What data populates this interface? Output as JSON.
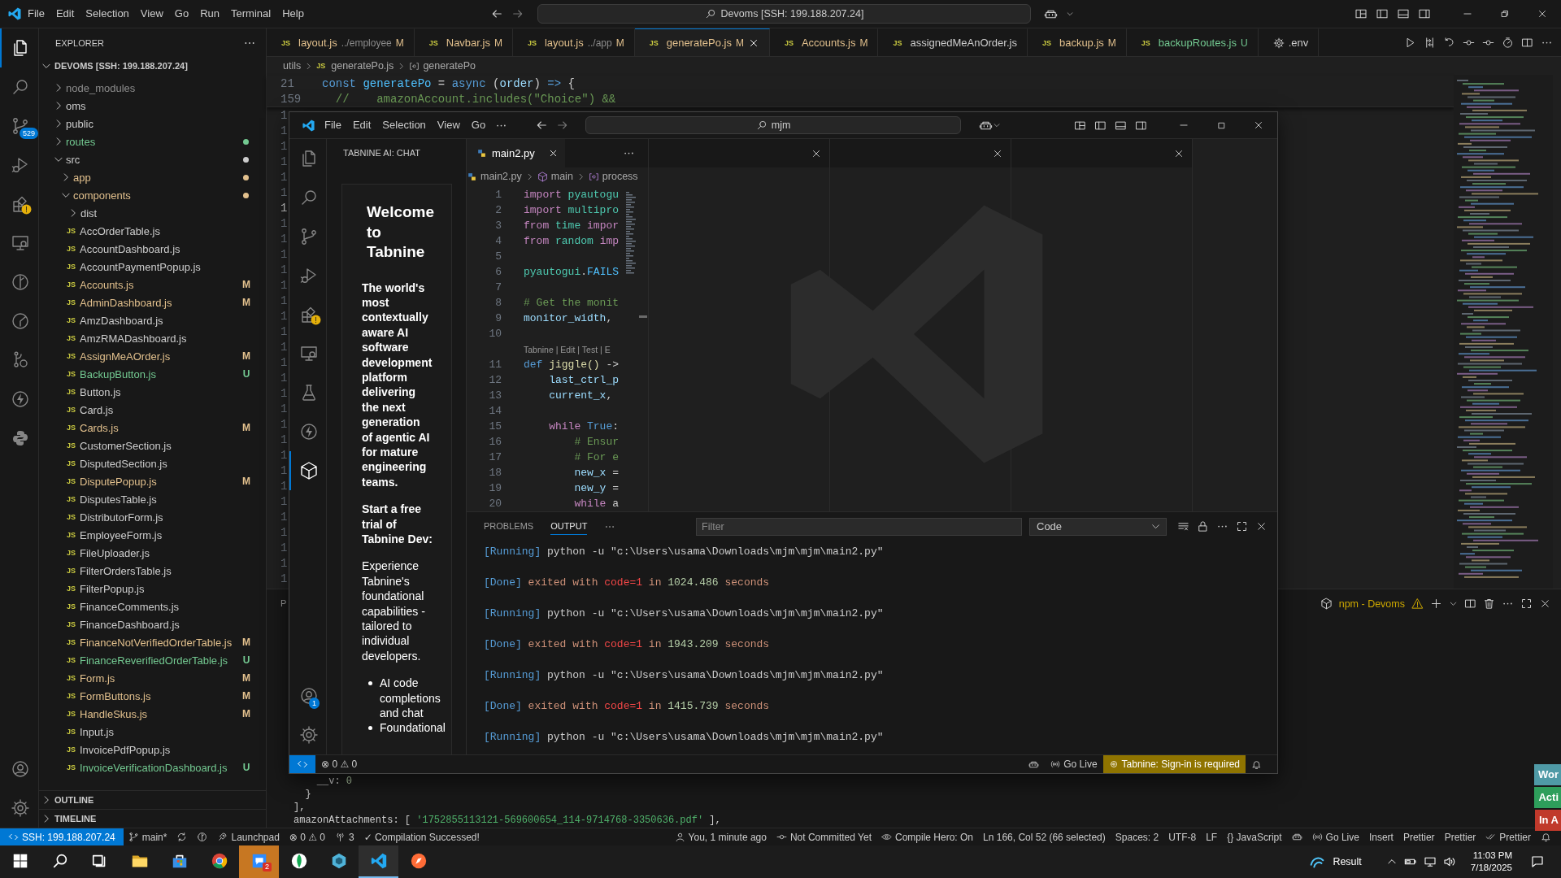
{
  "window": {
    "title": "Devoms [SSH: 199.188.207.24]",
    "menu": [
      "File",
      "Edit",
      "Selection",
      "View",
      "Go",
      "Run",
      "Terminal",
      "Help"
    ]
  },
  "activity_bar": {
    "items": [
      {
        "kind": "files",
        "selected": true,
        "warning": false
      },
      {
        "kind": "search",
        "selected": false,
        "warning": false
      },
      {
        "kind": "scm",
        "selected": false,
        "warning": false,
        "badge": "529"
      },
      {
        "kind": "run",
        "selected": false,
        "warning": false
      },
      {
        "kind": "extensions",
        "selected": false,
        "warning": true
      },
      {
        "kind": "remote",
        "selected": false,
        "warning": false
      },
      {
        "kind": "graph",
        "selected": false,
        "warning": false
      },
      {
        "kind": "gauge",
        "selected": false,
        "warning": false
      },
      {
        "kind": "branch",
        "selected": false,
        "warning": false
      },
      {
        "kind": "bolt",
        "selected": false,
        "warning": false
      },
      {
        "kind": "python",
        "selected": false,
        "warning": false
      }
    ],
    "bottom": [
      {
        "kind": "account",
        "selected": false
      },
      {
        "kind": "settings",
        "selected": false
      }
    ]
  },
  "explorer": {
    "title": "EXPLORER",
    "root": "DEVOMS [SSH: 199.188.207.24]",
    "root_expanded": true,
    "tree": [
      {
        "name": "node_modules",
        "kind": "folder",
        "expanded": false,
        "color": "#8c8c8c",
        "dot": false
      },
      {
        "name": "oms",
        "kind": "folder",
        "expanded": false,
        "color": "#cccccc",
        "dot": false
      },
      {
        "name": "public",
        "kind": "folder",
        "expanded": false,
        "color": "#cccccc",
        "dot": false
      },
      {
        "name": "routes",
        "kind": "folder",
        "expanded": false,
        "color": "#73c991",
        "dot": true
      },
      {
        "name": "src",
        "kind": "folder",
        "expanded": true,
        "color": "#cccccc",
        "dot": true,
        "children": [
          {
            "name": "app",
            "kind": "folder",
            "expanded": false,
            "color": "#e2c08d",
            "dot": true
          },
          {
            "name": "components",
            "kind": "folder",
            "expanded": true,
            "color": "#e2c08d",
            "dot": true,
            "children": [
              {
                "name": "dist",
                "kind": "folder",
                "expanded": false,
                "color": "#cccccc",
                "dot": false
              },
              {
                "name": "AccOrderTable.js",
                "kind": "file",
                "icon": "JS",
                "color": "#cccccc"
              },
              {
                "name": "AccountDashboard.js",
                "kind": "file",
                "icon": "JS",
                "color": "#cccccc"
              },
              {
                "name": "AccountPaymentPopup.js",
                "kind": "file",
                "icon": "JS",
                "color": "#cccccc"
              },
              {
                "name": "Accounts.js",
                "kind": "file",
                "icon": "JS",
                "color": "#e2c08d",
                "badge": "M"
              },
              {
                "name": "AdminDashboard.js",
                "kind": "file",
                "icon": "JS",
                "color": "#e2c08d",
                "badge": "M"
              },
              {
                "name": "AmzDashboard.js",
                "kind": "file",
                "icon": "JS",
                "color": "#cccccc"
              },
              {
                "name": "AmzRMADashboard.js",
                "kind": "file",
                "icon": "JS",
                "color": "#cccccc"
              },
              {
                "name": "AssignMeAOrder.js",
                "kind": "file",
                "icon": "JS",
                "color": "#e2c08d",
                "badge": "M"
              },
              {
                "name": "BackupButton.js",
                "kind": "file",
                "icon": "JS",
                "color": "#73c991",
                "badge": "U"
              },
              {
                "name": "Button.js",
                "kind": "file",
                "icon": "JS",
                "color": "#cccccc"
              },
              {
                "name": "Card.js",
                "kind": "file",
                "icon": "JS",
                "color": "#cccccc"
              },
              {
                "name": "Cards.js",
                "kind": "file",
                "icon": "JS",
                "color": "#e2c08d",
                "badge": "M"
              },
              {
                "name": "CustomerSection.js",
                "kind": "file",
                "icon": "JS",
                "color": "#cccccc"
              },
              {
                "name": "DisputedSection.js",
                "kind": "file",
                "icon": "JS",
                "color": "#cccccc"
              },
              {
                "name": "DisputePopup.js",
                "kind": "file",
                "icon": "JS",
                "color": "#e2c08d",
                "badge": "M"
              },
              {
                "name": "DisputesTable.js",
                "kind": "file",
                "icon": "JS",
                "color": "#cccccc"
              },
              {
                "name": "DistributorForm.js",
                "kind": "file",
                "icon": "JS",
                "color": "#cccccc"
              },
              {
                "name": "EmployeeForm.js",
                "kind": "file",
                "icon": "JS",
                "color": "#cccccc"
              },
              {
                "name": "FileUploader.js",
                "kind": "file",
                "icon": "JS",
                "color": "#cccccc"
              },
              {
                "name": "FilterOrdersTable.js",
                "kind": "file",
                "icon": "JS",
                "color": "#cccccc"
              },
              {
                "name": "FilterPopup.js",
                "kind": "file",
                "icon": "JS",
                "color": "#cccccc"
              },
              {
                "name": "FinanceComments.js",
                "kind": "file",
                "icon": "JS",
                "color": "#cccccc"
              },
              {
                "name": "FinanceDashboard.js",
                "kind": "file",
                "icon": "JS",
                "color": "#cccccc"
              },
              {
                "name": "FinanceNotVerifiedOrderTable.js",
                "kind": "file",
                "icon": "JS",
                "color": "#e2c08d",
                "badge": "M"
              },
              {
                "name": "FinanceReverifiedOrderTable.js",
                "kind": "file",
                "icon": "JS",
                "color": "#73c991",
                "badge": "U"
              },
              {
                "name": "Form.js",
                "kind": "file",
                "icon": "JS",
                "color": "#e2c08d",
                "badge": "M"
              },
              {
                "name": "FormButtons.js",
                "kind": "file",
                "icon": "JS",
                "color": "#e2c08d",
                "badge": "M"
              },
              {
                "name": "HandleSkus.js",
                "kind": "file",
                "icon": "JS",
                "color": "#e2c08d",
                "badge": "M"
              },
              {
                "name": "Input.js",
                "kind": "file",
                "icon": "JS",
                "color": "#cccccc"
              },
              {
                "name": "InvoicePdfPopup.js",
                "kind": "file",
                "icon": "JS",
                "color": "#cccccc"
              },
              {
                "name": "InvoiceVerificationDashboard.js",
                "kind": "file",
                "icon": "JS",
                "color": "#73c991",
                "badge": "U"
              }
            ]
          }
        ]
      }
    ],
    "sections": [
      {
        "title": "OUTLINE",
        "expanded": false
      },
      {
        "title": "TIMELINE",
        "expanded": false
      }
    ]
  },
  "tabs": [
    {
      "icon": "JS",
      "label": "layout.js",
      "hint": "../employee",
      "badge": "M",
      "color": "#e2c08d",
      "selected": false
    },
    {
      "icon": "JS",
      "label": "Navbar.js",
      "badge": "M",
      "color": "#e2c08d",
      "selected": false
    },
    {
      "icon": "JS",
      "label": "layout.js",
      "hint": "../app",
      "badge": "M",
      "color": "#e2c08d",
      "selected": false
    },
    {
      "icon": "JS",
      "label": "generatePo.js",
      "badge": "M",
      "color": "#e2c08d",
      "selected": true
    },
    {
      "icon": "JS",
      "label": "Accounts.js",
      "badge": "M",
      "color": "#e2c08d",
      "selected": false
    },
    {
      "icon": "JS",
      "label": "assignedMeAnOrder.js",
      "color": "#cccccc",
      "selected": false
    },
    {
      "icon": "JS",
      "label": "backup.js",
      "badge": "M",
      "color": "#e2c08d",
      "selected": false
    },
    {
      "icon": "JS",
      "label": "backupRoutes.js",
      "badge": "U",
      "color": "#73c991",
      "selected": false
    },
    {
      "kind": "settings",
      "label": ".env",
      "color": "#cccccc",
      "selected": false
    }
  ],
  "breadcrumb": [
    {
      "kind": "folder",
      "text": "utils"
    },
    {
      "kind": "js",
      "icon": "JS",
      "text": "generatePo.js"
    },
    {
      "kind": "symbol",
      "text": "generatePo"
    }
  ],
  "editor": {
    "sticky_lines": [
      {
        "number": "21",
        "tokens": [
          {
            "text": "const ",
            "kind": "kw"
          },
          {
            "text": "generatePo",
            "kind": "const"
          },
          {
            "text": " = ",
            "kind": "p"
          },
          {
            "text": "async",
            "kind": "kw"
          },
          {
            "text": " (",
            "kind": "p"
          },
          {
            "text": "order",
            "kind": "var"
          },
          {
            "text": ") ",
            "kind": "p"
          },
          {
            "text": "=>",
            "kind": "kw"
          },
          {
            "text": " {",
            "kind": "p"
          }
        ]
      },
      {
        "number": "159",
        "tokens": [
          {
            "text": "  //    amazonAccount.includes(\"Choice\") &&",
            "kind": "cm"
          }
        ]
      }
    ],
    "gutter": [
      {
        "number": "1",
        "current": false
      },
      {
        "number": "1",
        "current": false
      },
      {
        "number": "1",
        "current": false
      },
      {
        "number": "1",
        "current": false
      },
      {
        "number": "1",
        "current": false
      },
      {
        "number": "1",
        "current": false
      },
      {
        "number": "1",
        "current": true
      },
      {
        "number": "1",
        "current": false
      },
      {
        "number": "1",
        "current": false
      },
      {
        "number": "1",
        "current": false
      },
      {
        "number": "1",
        "current": false
      },
      {
        "number": "1",
        "current": false
      },
      {
        "number": "1",
        "current": false
      },
      {
        "number": "1",
        "current": false
      },
      {
        "number": "1",
        "current": false
      },
      {
        "number": "1",
        "current": false
      },
      {
        "number": "1",
        "current": false
      },
      {
        "number": "1",
        "current": false
      },
      {
        "number": "1",
        "current": false
      },
      {
        "number": "1",
        "current": false
      },
      {
        "number": "1",
        "current": false
      },
      {
        "number": "1",
        "current": false
      },
      {
        "number": "1",
        "current": false
      },
      {
        "number": "1",
        "current": false
      },
      {
        "number": "1",
        "current": false
      },
      {
        "number": "1",
        "current": false
      },
      {
        "number": "1",
        "current": false
      },
      {
        "number": "1",
        "current": false
      },
      {
        "number": "1",
        "current": false
      },
      {
        "number": "1",
        "current": false
      },
      {
        "number": "1",
        "current": false
      }
    ]
  },
  "panel": {
    "tabs": [
      {
        "label": "P",
        "selected": false
      }
    ],
    "terminal": "npm - Devoms",
    "terminal_warning": true,
    "lines": [
      {
        "tokens": [
          {
            "text": "    __v: ",
            "kind": "p"
          },
          {
            "text": "0",
            "kind": "num"
          }
        ]
      },
      {
        "tokens": [
          {
            "text": "  }",
            "kind": "p"
          }
        ]
      },
      {
        "tokens": [
          {
            "text": "],",
            "kind": "p"
          }
        ]
      },
      {
        "tokens": [
          {
            "text": "amazonAttachments: [ ",
            "kind": "p"
          },
          {
            "text": "'1752855113121-569600654_114-9714768-3350636.pdf'",
            "kind": "tstr"
          },
          {
            "text": " ],",
            "kind": "p"
          }
        ]
      }
    ]
  },
  "inner_window": {
    "menu": [
      "File",
      "Edit",
      "Selection",
      "View",
      "Go"
    ],
    "search": "mjm",
    "activity_bar": {
      "items": [
        {
          "kind": "files",
          "selected": false,
          "warning": false
        },
        {
          "kind": "search",
          "selected": false,
          "warning": false
        },
        {
          "kind": "scm",
          "selected": false,
          "warning": false
        },
        {
          "kind": "run",
          "selected": false,
          "warning": false
        },
        {
          "kind": "extensions",
          "selected": false,
          "warning": true
        },
        {
          "kind": "remote",
          "selected": false,
          "warning": false
        },
        {
          "kind": "testing",
          "selected": false,
          "warning": false
        },
        {
          "kind": "bolt",
          "selected": false,
          "warning": false
        },
        {
          "kind": "tabnine",
          "selected": true,
          "warning": false
        }
      ],
      "bottom": [
        {
          "kind": "account",
          "selected": false,
          "badge": "1"
        },
        {
          "kind": "settings",
          "selected": false
        }
      ]
    },
    "sidebar": {
      "title": "TABNINE AI: CHAT",
      "card": {
        "title": "Welcome to Tabnine",
        "intro": "The world's most contextually aware AI software development platform delivering the next generation of agentic AI for mature engineering teams.",
        "trial_heading": "Start a free trial of Tabnine Dev:",
        "trial_text": "Experience Tabnine's foundational capabilities - tailored to individual developers.",
        "features": [
          "AI code completions and chat",
          "Foundational"
        ]
      }
    },
    "editor": {
      "tab": {
        "label": "main2.py",
        "selected": true
      },
      "breadcrumb": [
        {
          "kind": "file",
          "text": "main2.py"
        },
        {
          "kind": "module",
          "text": "main"
        },
        {
          "kind": "symbol",
          "text": "process"
        }
      ],
      "lines": [
        {
          "kind": "code",
          "number": "1",
          "tokens": [
            {
              "text": "import ",
              "kind": "ctl"
            },
            {
              "text": "pyautogu",
              "kind": "mod"
            }
          ]
        },
        {
          "kind": "code",
          "number": "2",
          "tokens": [
            {
              "text": "import ",
              "kind": "ctl"
            },
            {
              "text": "multipro",
              "kind": "mod"
            }
          ]
        },
        {
          "kind": "code",
          "number": "3",
          "tokens": [
            {
              "text": "from ",
              "kind": "ctl"
            },
            {
              "text": "time ",
              "kind": "mod"
            },
            {
              "text": "impor",
              "kind": "ctl"
            }
          ]
        },
        {
          "kind": "code",
          "number": "4",
          "tokens": [
            {
              "text": "from ",
              "kind": "ctl"
            },
            {
              "text": "random ",
              "kind": "mod"
            },
            {
              "text": "imp",
              "kind": "ctl"
            }
          ]
        },
        {
          "kind": "code",
          "number": "5"
        },
        {
          "kind": "code",
          "number": "6",
          "tokens": [
            {
              "text": "pyautogui",
              "kind": "mod"
            },
            {
              "text": ".",
              "kind": "p"
            },
            {
              "text": "FAILS",
              "kind": "const"
            }
          ]
        },
        {
          "kind": "code",
          "number": "7"
        },
        {
          "kind": "code",
          "number": "8",
          "tokens": [
            {
              "text": "# Get the monit",
              "kind": "cm"
            }
          ]
        },
        {
          "kind": "code",
          "number": "9",
          "tokens": [
            {
              "text": "monitor_width",
              "kind": "var"
            },
            {
              "text": ",",
              "kind": "p"
            }
          ]
        },
        {
          "kind": "code",
          "number": "10"
        },
        {
          "kind": "codelens",
          "text": "Tabnine | Edit | Test | E"
        },
        {
          "kind": "code",
          "number": "11",
          "tokens": [
            {
              "text": "def ",
              "kind": "kw"
            },
            {
              "text": "jiggle()",
              "kind": "fn"
            },
            {
              "text": " ->",
              "kind": "p"
            }
          ]
        },
        {
          "kind": "code",
          "number": "12",
          "tokens": [
            {
              "text": "    last_ctrl_p",
              "kind": "var"
            }
          ]
        },
        {
          "kind": "code",
          "number": "13",
          "tokens": [
            {
              "text": "    current_x",
              "kind": "var"
            },
            {
              "text": ",",
              "kind": "p"
            }
          ]
        },
        {
          "kind": "code",
          "number": "14"
        },
        {
          "kind": "code",
          "number": "15",
          "tokens": [
            {
              "text": "    while ",
              "kind": "ctl"
            },
            {
              "text": "True",
              "kind": "kw"
            },
            {
              "text": ":",
              "kind": "p"
            }
          ]
        },
        {
          "kind": "code",
          "number": "16",
          "tokens": [
            {
              "text": "        # Ensur",
              "kind": "cm"
            }
          ]
        },
        {
          "kind": "code",
          "number": "17",
          "tokens": [
            {
              "text": "        # For e",
              "kind": "cm"
            }
          ]
        },
        {
          "kind": "code",
          "number": "18",
          "tokens": [
            {
              "text": "        new_x",
              "kind": "var"
            },
            {
              "text": " =",
              "kind": "p"
            }
          ]
        },
        {
          "kind": "code",
          "number": "19",
          "tokens": [
            {
              "text": "        new_y",
              "kind": "var"
            },
            {
              "text": " =",
              "kind": "p"
            }
          ]
        },
        {
          "kind": "code",
          "number": "20",
          "tokens": [
            {
              "text": "        while",
              "kind": "ctl"
            },
            {
              "text": " a",
              "kind": "p"
            }
          ]
        }
      ]
    },
    "empty_groups": [
      {
        "closable": true
      },
      {
        "closable": true
      },
      {
        "closable": true
      }
    ],
    "panel": {
      "tabs": [
        {
          "label": "PROBLEMS",
          "selected": false
        },
        {
          "label": "OUTPUT",
          "selected": true
        }
      ],
      "filter": {
        "placeholder": "Filter"
      },
      "channel": "Code",
      "output": [
        {
          "tokens": [
            {
              "text": "[Running]",
              "kind": "tag"
            },
            {
              "text": " python -u \"c:\\Users\\usama\\Downloads\\mjm\\mjm\\main2.py\"",
              "kind": "p"
            }
          ]
        },
        {
          "tokens": [
            {
              "text": "[Done]",
              "kind": "tag"
            },
            {
              "text": " exited with ",
              "kind": "str"
            },
            {
              "text": "code=1",
              "kind": "err"
            },
            {
              "text": " in ",
              "kind": "str"
            },
            {
              "text": "1024.486",
              "kind": "num"
            },
            {
              "text": " seconds",
              "kind": "str"
            }
          ]
        },
        {
          "tokens": [
            {
              "text": "[Running]",
              "kind": "tag"
            },
            {
              "text": " python -u \"c:\\Users\\usama\\Downloads\\mjm\\mjm\\main2.py\"",
              "kind": "p"
            }
          ]
        },
        {
          "tokens": [
            {
              "text": "[Done]",
              "kind": "tag"
            },
            {
              "text": " exited with ",
              "kind": "str"
            },
            {
              "text": "code=1",
              "kind": "err"
            },
            {
              "text": " in ",
              "kind": "str"
            },
            {
              "text": "1943.209",
              "kind": "num"
            },
            {
              "text": " seconds",
              "kind": "str"
            }
          ]
        },
        {
          "tokens": [
            {
              "text": "[Running]",
              "kind": "tag"
            },
            {
              "text": " python -u \"c:\\Users\\usama\\Downloads\\mjm\\mjm\\main2.py\"",
              "kind": "p"
            }
          ]
        },
        {
          "tokens": [
            {
              "text": "[Done]",
              "kind": "tag"
            },
            {
              "text": " exited with ",
              "kind": "str"
            },
            {
              "text": "code=1",
              "kind": "err"
            },
            {
              "text": " in ",
              "kind": "str"
            },
            {
              "text": "1415.739",
              "kind": "num"
            },
            {
              "text": " seconds",
              "kind": "str"
            }
          ]
        },
        {
          "tokens": [
            {
              "text": "[Running]",
              "kind": "tag"
            },
            {
              "text": " python -u \"c:\\Users\\usama\\Downloads\\mjm\\mjm\\main2.py\"",
              "kind": "p"
            }
          ]
        }
      ]
    },
    "status_bar": {
      "problems": "⊗ 0 ⚠ 0",
      "items": [
        {
          "kind": "robot"
        },
        {
          "kind": "broadcast",
          "text": "Go Live"
        },
        {
          "kind": "tabnine",
          "text": "Tabnine: Sign-in is required",
          "warning": true
        },
        {
          "kind": "bell"
        }
      ]
    }
  },
  "status_bar": {
    "left": [
      {
        "kind": "remote",
        "text": "SSH: 199.188.207.24"
      },
      {
        "kind": "branch",
        "text": "main*"
      },
      {
        "kind": "sync"
      },
      {
        "kind": "graph"
      },
      {
        "kind": "launch",
        "text": "Launchpad"
      },
      {
        "kind": "plain",
        "text": "⊗ 0 ⚠ 0"
      },
      {
        "kind": "ports",
        "text": "3"
      },
      {
        "kind": "plain",
        "text": "✓ Compilation Successed!"
      }
    ],
    "right": [
      {
        "kind": "person",
        "text": "You, 1 minute ago"
      },
      {
        "kind": "commit",
        "text": "Not Committed Yet"
      },
      {
        "kind": "eye",
        "text": "Compile Hero: On"
      },
      {
        "kind": "plain",
        "text": "Ln 166, Col 52 (66 selected)"
      },
      {
        "kind": "plain",
        "text": "Spaces: 2"
      },
      {
        "kind": "plain",
        "text": "UTF-8"
      },
      {
        "kind": "plain",
        "text": "LF"
      },
      {
        "kind": "plain",
        "text": "{} JavaScript"
      },
      {
        "kind": "robot"
      },
      {
        "kind": "broadcast",
        "text": "Go Live"
      },
      {
        "kind": "plain",
        "text": "Insert"
      },
      {
        "kind": "plain",
        "text": "Prettier"
      },
      {
        "kind": "plain",
        "text": "Prettier"
      },
      {
        "kind": "checks",
        "text": "Prettier"
      },
      {
        "kind": "bell"
      }
    ]
  },
  "side_tags": [
    {
      "text": "Wor",
      "color": "#4f9aa6"
    },
    {
      "text": "Acti",
      "color": "#2e9e5b"
    },
    {
      "text": "In A",
      "color": "#c0392b"
    }
  ],
  "taskbar": {
    "apps": [
      {
        "kind": "start",
        "selected": false,
        "flashing": false
      },
      {
        "kind": "search",
        "selected": false,
        "flashing": false
      },
      {
        "kind": "taskview",
        "selected": false,
        "flashing": false
      },
      {
        "kind": "folder",
        "selected": false,
        "flashing": false
      },
      {
        "kind": "store",
        "selected": false,
        "flashing": false
      },
      {
        "kind": "chrome",
        "selected": false,
        "flashing": false
      },
      {
        "kind": "chat",
        "selected": false,
        "flashing": true,
        "badge": "2"
      },
      {
        "kind": "leaf",
        "selected": false,
        "flashing": false
      },
      {
        "kind": "hexapp",
        "selected": false,
        "flashing": false
      },
      {
        "kind": "vscode",
        "selected": true,
        "flashing": false
      },
      {
        "kind": "compass",
        "selected": false,
        "flashing": false
      }
    ],
    "weather": "Result",
    "time": "11:03 PM",
    "date": "7/18/2025"
  }
}
